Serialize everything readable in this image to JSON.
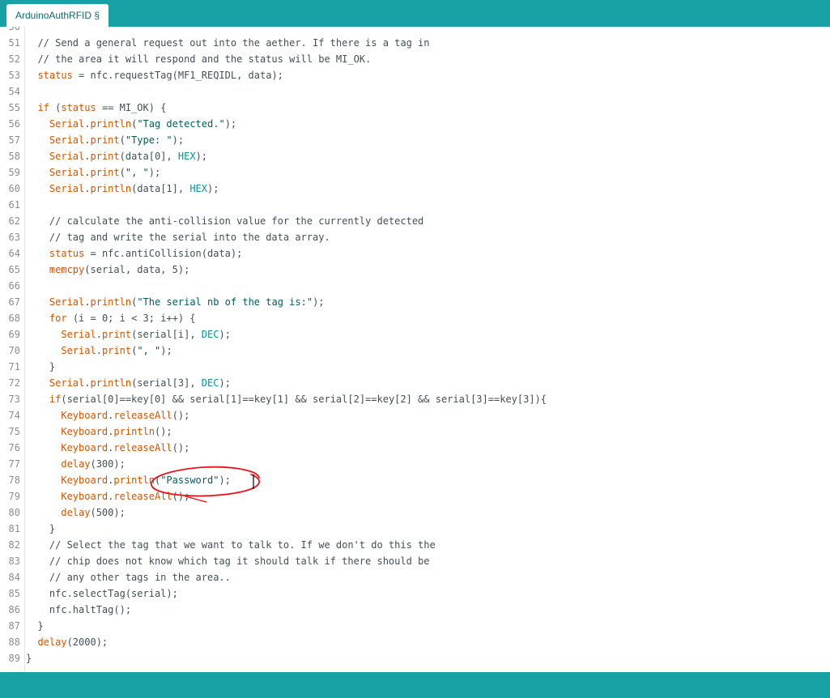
{
  "tab": {
    "label": "ArduinoAuthRFID §"
  },
  "editor": {
    "first_line_number": 50,
    "lines": [
      [
        {
          "t": "",
          "c": "df"
        }
      ],
      [
        {
          "t": "  // Send a general request out into the aether. If there is a tag in",
          "c": "cm"
        }
      ],
      [
        {
          "t": "  // the area it will respond and the status will be MI_OK.",
          "c": "cm"
        }
      ],
      [
        {
          "t": "  ",
          "c": "df"
        },
        {
          "t": "status",
          "c": "kw"
        },
        {
          "t": " = nfc.requestTag(MF1_REQIDL, data);",
          "c": "df"
        }
      ],
      [
        {
          "t": "",
          "c": "df"
        }
      ],
      [
        {
          "t": "  ",
          "c": "df"
        },
        {
          "t": "if",
          "c": "kw"
        },
        {
          "t": " (",
          "c": "df"
        },
        {
          "t": "status",
          "c": "kw"
        },
        {
          "t": " == MI_OK) {",
          "c": "df"
        }
      ],
      [
        {
          "t": "    ",
          "c": "df"
        },
        {
          "t": "Serial",
          "c": "ob"
        },
        {
          "t": ".",
          "c": "df"
        },
        {
          "t": "println",
          "c": "kw"
        },
        {
          "t": "(",
          "c": "df"
        },
        {
          "t": "\"Tag detected.\"",
          "c": "st"
        },
        {
          "t": ");",
          "c": "df"
        }
      ],
      [
        {
          "t": "    ",
          "c": "df"
        },
        {
          "t": "Serial",
          "c": "ob"
        },
        {
          "t": ".",
          "c": "df"
        },
        {
          "t": "print",
          "c": "kw"
        },
        {
          "t": "(",
          "c": "df"
        },
        {
          "t": "\"Type: \"",
          "c": "st"
        },
        {
          "t": ");",
          "c": "df"
        }
      ],
      [
        {
          "t": "    ",
          "c": "df"
        },
        {
          "t": "Serial",
          "c": "ob"
        },
        {
          "t": ".",
          "c": "df"
        },
        {
          "t": "print",
          "c": "kw"
        },
        {
          "t": "(data[0], ",
          "c": "df"
        },
        {
          "t": "HEX",
          "c": "ct"
        },
        {
          "t": ");",
          "c": "df"
        }
      ],
      [
        {
          "t": "    ",
          "c": "df"
        },
        {
          "t": "Serial",
          "c": "ob"
        },
        {
          "t": ".",
          "c": "df"
        },
        {
          "t": "print",
          "c": "kw"
        },
        {
          "t": "(",
          "c": "df"
        },
        {
          "t": "\", \"",
          "c": "st"
        },
        {
          "t": ");",
          "c": "df"
        }
      ],
      [
        {
          "t": "    ",
          "c": "df"
        },
        {
          "t": "Serial",
          "c": "ob"
        },
        {
          "t": ".",
          "c": "df"
        },
        {
          "t": "println",
          "c": "kw"
        },
        {
          "t": "(data[1], ",
          "c": "df"
        },
        {
          "t": "HEX",
          "c": "ct"
        },
        {
          "t": ");",
          "c": "df"
        }
      ],
      [
        {
          "t": "",
          "c": "df"
        }
      ],
      [
        {
          "t": "    // calculate the anti-collision value for the currently detected",
          "c": "cm"
        }
      ],
      [
        {
          "t": "    // tag and write the serial into the data array.",
          "c": "cm"
        }
      ],
      [
        {
          "t": "    ",
          "c": "df"
        },
        {
          "t": "status",
          "c": "kw"
        },
        {
          "t": " = nfc.antiCollision(data);",
          "c": "df"
        }
      ],
      [
        {
          "t": "    ",
          "c": "df"
        },
        {
          "t": "memcpy",
          "c": "kw"
        },
        {
          "t": "(serial, data, 5);",
          "c": "df"
        }
      ],
      [
        {
          "t": "",
          "c": "df"
        }
      ],
      [
        {
          "t": "    ",
          "c": "df"
        },
        {
          "t": "Serial",
          "c": "ob"
        },
        {
          "t": ".",
          "c": "df"
        },
        {
          "t": "println",
          "c": "kw"
        },
        {
          "t": "(",
          "c": "df"
        },
        {
          "t": "\"The serial nb of the tag is:\"",
          "c": "st"
        },
        {
          "t": ");",
          "c": "df"
        }
      ],
      [
        {
          "t": "    ",
          "c": "df"
        },
        {
          "t": "for",
          "c": "kw"
        },
        {
          "t": " (i = 0; i < 3; i++) {",
          "c": "df"
        }
      ],
      [
        {
          "t": "      ",
          "c": "df"
        },
        {
          "t": "Serial",
          "c": "ob"
        },
        {
          "t": ".",
          "c": "df"
        },
        {
          "t": "print",
          "c": "kw"
        },
        {
          "t": "(serial[i], ",
          "c": "df"
        },
        {
          "t": "DEC",
          "c": "ct"
        },
        {
          "t": ");",
          "c": "df"
        }
      ],
      [
        {
          "t": "      ",
          "c": "df"
        },
        {
          "t": "Serial",
          "c": "ob"
        },
        {
          "t": ".",
          "c": "df"
        },
        {
          "t": "print",
          "c": "kw"
        },
        {
          "t": "(",
          "c": "df"
        },
        {
          "t": "\", \"",
          "c": "st"
        },
        {
          "t": ");",
          "c": "df"
        }
      ],
      [
        {
          "t": "    }",
          "c": "df"
        }
      ],
      [
        {
          "t": "    ",
          "c": "df"
        },
        {
          "t": "Serial",
          "c": "ob"
        },
        {
          "t": ".",
          "c": "df"
        },
        {
          "t": "println",
          "c": "kw"
        },
        {
          "t": "(serial[3], ",
          "c": "df"
        },
        {
          "t": "DEC",
          "c": "ct"
        },
        {
          "t": ");",
          "c": "df"
        }
      ],
      [
        {
          "t": "    ",
          "c": "df"
        },
        {
          "t": "if",
          "c": "kw"
        },
        {
          "t": "(serial[0]==key[0] && serial[1]==key[1] && serial[2]==key[2] && serial[3]==key[3]){",
          "c": "df"
        }
      ],
      [
        {
          "t": "      ",
          "c": "df"
        },
        {
          "t": "Keyboard",
          "c": "ob"
        },
        {
          "t": ".",
          "c": "df"
        },
        {
          "t": "releaseAll",
          "c": "kw"
        },
        {
          "t": "();",
          "c": "df"
        }
      ],
      [
        {
          "t": "      ",
          "c": "df"
        },
        {
          "t": "Keyboard",
          "c": "ob"
        },
        {
          "t": ".",
          "c": "df"
        },
        {
          "t": "println",
          "c": "kw"
        },
        {
          "t": "();",
          "c": "df"
        }
      ],
      [
        {
          "t": "      ",
          "c": "df"
        },
        {
          "t": "Keyboard",
          "c": "ob"
        },
        {
          "t": ".",
          "c": "df"
        },
        {
          "t": "releaseAll",
          "c": "kw"
        },
        {
          "t": "();",
          "c": "df"
        }
      ],
      [
        {
          "t": "      ",
          "c": "df"
        },
        {
          "t": "delay",
          "c": "kw"
        },
        {
          "t": "(300);",
          "c": "df"
        }
      ],
      [
        {
          "t": "      ",
          "c": "df"
        },
        {
          "t": "Keyboard",
          "c": "ob"
        },
        {
          "t": ".",
          "c": "df"
        },
        {
          "t": "println",
          "c": "kw"
        },
        {
          "t": "(",
          "c": "df"
        },
        {
          "t": "\"Password\"",
          "c": "st"
        },
        {
          "t": ");",
          "c": "df"
        }
      ],
      [
        {
          "t": "      ",
          "c": "df"
        },
        {
          "t": "Keyboard",
          "c": "ob"
        },
        {
          "t": ".",
          "c": "df"
        },
        {
          "t": "releaseAll",
          "c": "kw"
        },
        {
          "t": "();",
          "c": "df"
        }
      ],
      [
        {
          "t": "      ",
          "c": "df"
        },
        {
          "t": "delay",
          "c": "kw"
        },
        {
          "t": "(500);",
          "c": "df"
        }
      ],
      [
        {
          "t": "    }",
          "c": "df"
        }
      ],
      [
        {
          "t": "    // Select the tag that we want to talk to. If we don't do this the",
          "c": "cm"
        }
      ],
      [
        {
          "t": "    // chip does not know which tag it should talk if there should be",
          "c": "cm"
        }
      ],
      [
        {
          "t": "    // any other tags in the area..",
          "c": "cm"
        }
      ],
      [
        {
          "t": "    nfc.selectTag(serial);",
          "c": "df"
        }
      ],
      [
        {
          "t": "    nfc.haltTag();",
          "c": "df"
        }
      ],
      [
        {
          "t": "  }",
          "c": "df"
        }
      ],
      [
        {
          "t": "  ",
          "c": "df"
        },
        {
          "t": "delay",
          "c": "kw"
        },
        {
          "t": "(2000);",
          "c": "df"
        }
      ],
      [
        {
          "t": "}",
          "c": "df"
        }
      ]
    ]
  },
  "annotation": {
    "color": "#e8151b",
    "shape": "hand-drawn ellipse around println(\"Password\")"
  },
  "colors": {
    "accent": "#17a1a5",
    "keyword": "#d35400",
    "string": "#005c5f",
    "constant": "#00979c",
    "text": "#434f54"
  }
}
